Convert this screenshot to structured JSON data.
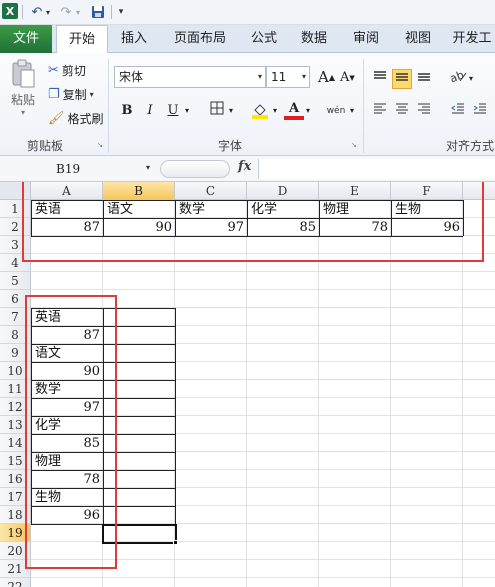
{
  "quick_access": {
    "app_icon": "excel-icon",
    "undo_icon": "undo-icon",
    "redo_icon": "redo-icon",
    "save_icon": "save-icon",
    "customize_icon": "chevron-down-icon"
  },
  "tabs": [
    {
      "label": "文件"
    },
    {
      "label": "开始"
    },
    {
      "label": "插入"
    },
    {
      "label": "页面布局"
    },
    {
      "label": "公式"
    },
    {
      "label": "数据"
    },
    {
      "label": "审阅"
    },
    {
      "label": "视图"
    },
    {
      "label": "开发工"
    }
  ],
  "ribbon": {
    "clipboard": {
      "paste_label": "粘贴",
      "cut_label": "剪切",
      "copy_label": "复制",
      "format_painter_label": "格式刷",
      "group_label": "剪贴板"
    },
    "font": {
      "font_name": "宋体",
      "font_size": "11",
      "bold": "B",
      "italic": "I",
      "underline": "U",
      "group_label": "字体",
      "grow_label": "A",
      "shrink_label": "A",
      "color_label": "A",
      "wen_label": "wén"
    },
    "alignment": {
      "group_label": "对齐方式"
    }
  },
  "formula_bar": {
    "name_box": "B19",
    "fx_label": "fx",
    "formula": ""
  },
  "grid": {
    "columns": [
      "A",
      "B",
      "C",
      "D",
      "E",
      "F"
    ],
    "selected_column": "B",
    "rows": [
      "1",
      "2",
      "3",
      "4",
      "5",
      "6",
      "7",
      "8",
      "9",
      "10",
      "11",
      "12",
      "13",
      "14",
      "15",
      "16",
      "17",
      "18",
      "19",
      "20",
      "21",
      "22"
    ],
    "selected_row": "19",
    "row1_headers": [
      "英语",
      "语文",
      "数学",
      "化学",
      "物理",
      "生物"
    ],
    "row2_values": [
      "87",
      "90",
      "97",
      "85",
      "78",
      "96"
    ],
    "column_list": [
      {
        "row": "7",
        "text": "英语"
      },
      {
        "row": "8",
        "text": "87"
      },
      {
        "row": "9",
        "text": "语文"
      },
      {
        "row": "10",
        "text": "90"
      },
      {
        "row": "11",
        "text": "数学"
      },
      {
        "row": "12",
        "text": "97"
      },
      {
        "row": "13",
        "text": "化学"
      },
      {
        "row": "14",
        "text": "85"
      },
      {
        "row": "15",
        "text": "物理"
      },
      {
        "row": "16",
        "text": "78"
      },
      {
        "row": "17",
        "text": "生物"
      },
      {
        "row": "18",
        "text": "96"
      }
    ]
  },
  "colors": {
    "file_tab": "#2e7d32",
    "annotation": "#e03a3a",
    "selection_header": "#f6c75d"
  }
}
